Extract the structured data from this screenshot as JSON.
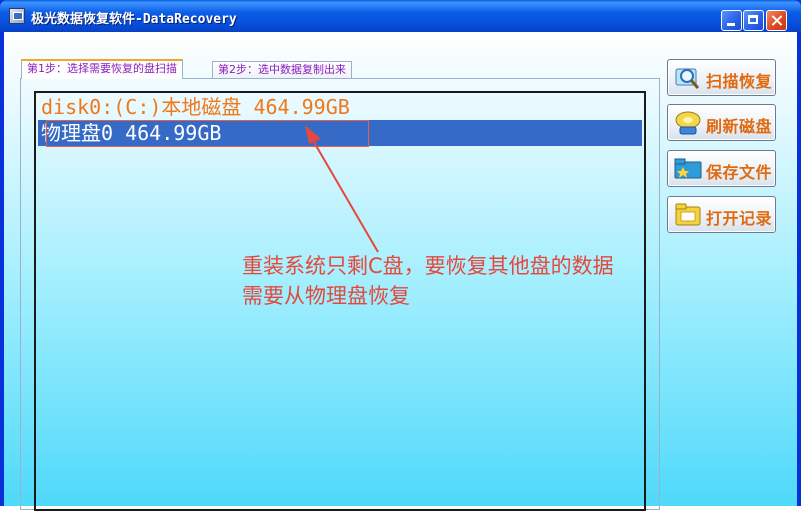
{
  "window": {
    "title": "极光数据恢复软件-DataRecovery"
  },
  "tabs": [
    {
      "label": "第1步：选择需要恢复的盘扫描",
      "selected": true
    },
    {
      "label": "第2步：选中数据复制出来",
      "selected": false
    }
  ],
  "disk_list": {
    "items": [
      {
        "label": "disk0:(C:)本地磁盘 464.99GB",
        "selected": false
      },
      {
        "label": "物理盘0 464.99GB",
        "selected": true
      }
    ]
  },
  "annotation": {
    "line1": "重装系统只剩C盘，要恢复其他盘的数据",
    "line2": "需要从物理盘恢复"
  },
  "buttons": {
    "scan": {
      "label": "扫描恢复",
      "icon": "magnifier-icon"
    },
    "refresh": {
      "label": "刷新磁盘",
      "icon": "disk-icon"
    },
    "save": {
      "label": "保存文件",
      "icon": "folder-icon"
    },
    "open_log": {
      "label": "打开记录",
      "icon": "log-folder-icon"
    }
  },
  "colors": {
    "titlebar": "#0b5ce6",
    "selection": "#356ac6",
    "item_text": "#f07818",
    "annotation": "#e5483c",
    "button_text": "#e06a10",
    "tab_text": "#8a1ec0"
  }
}
